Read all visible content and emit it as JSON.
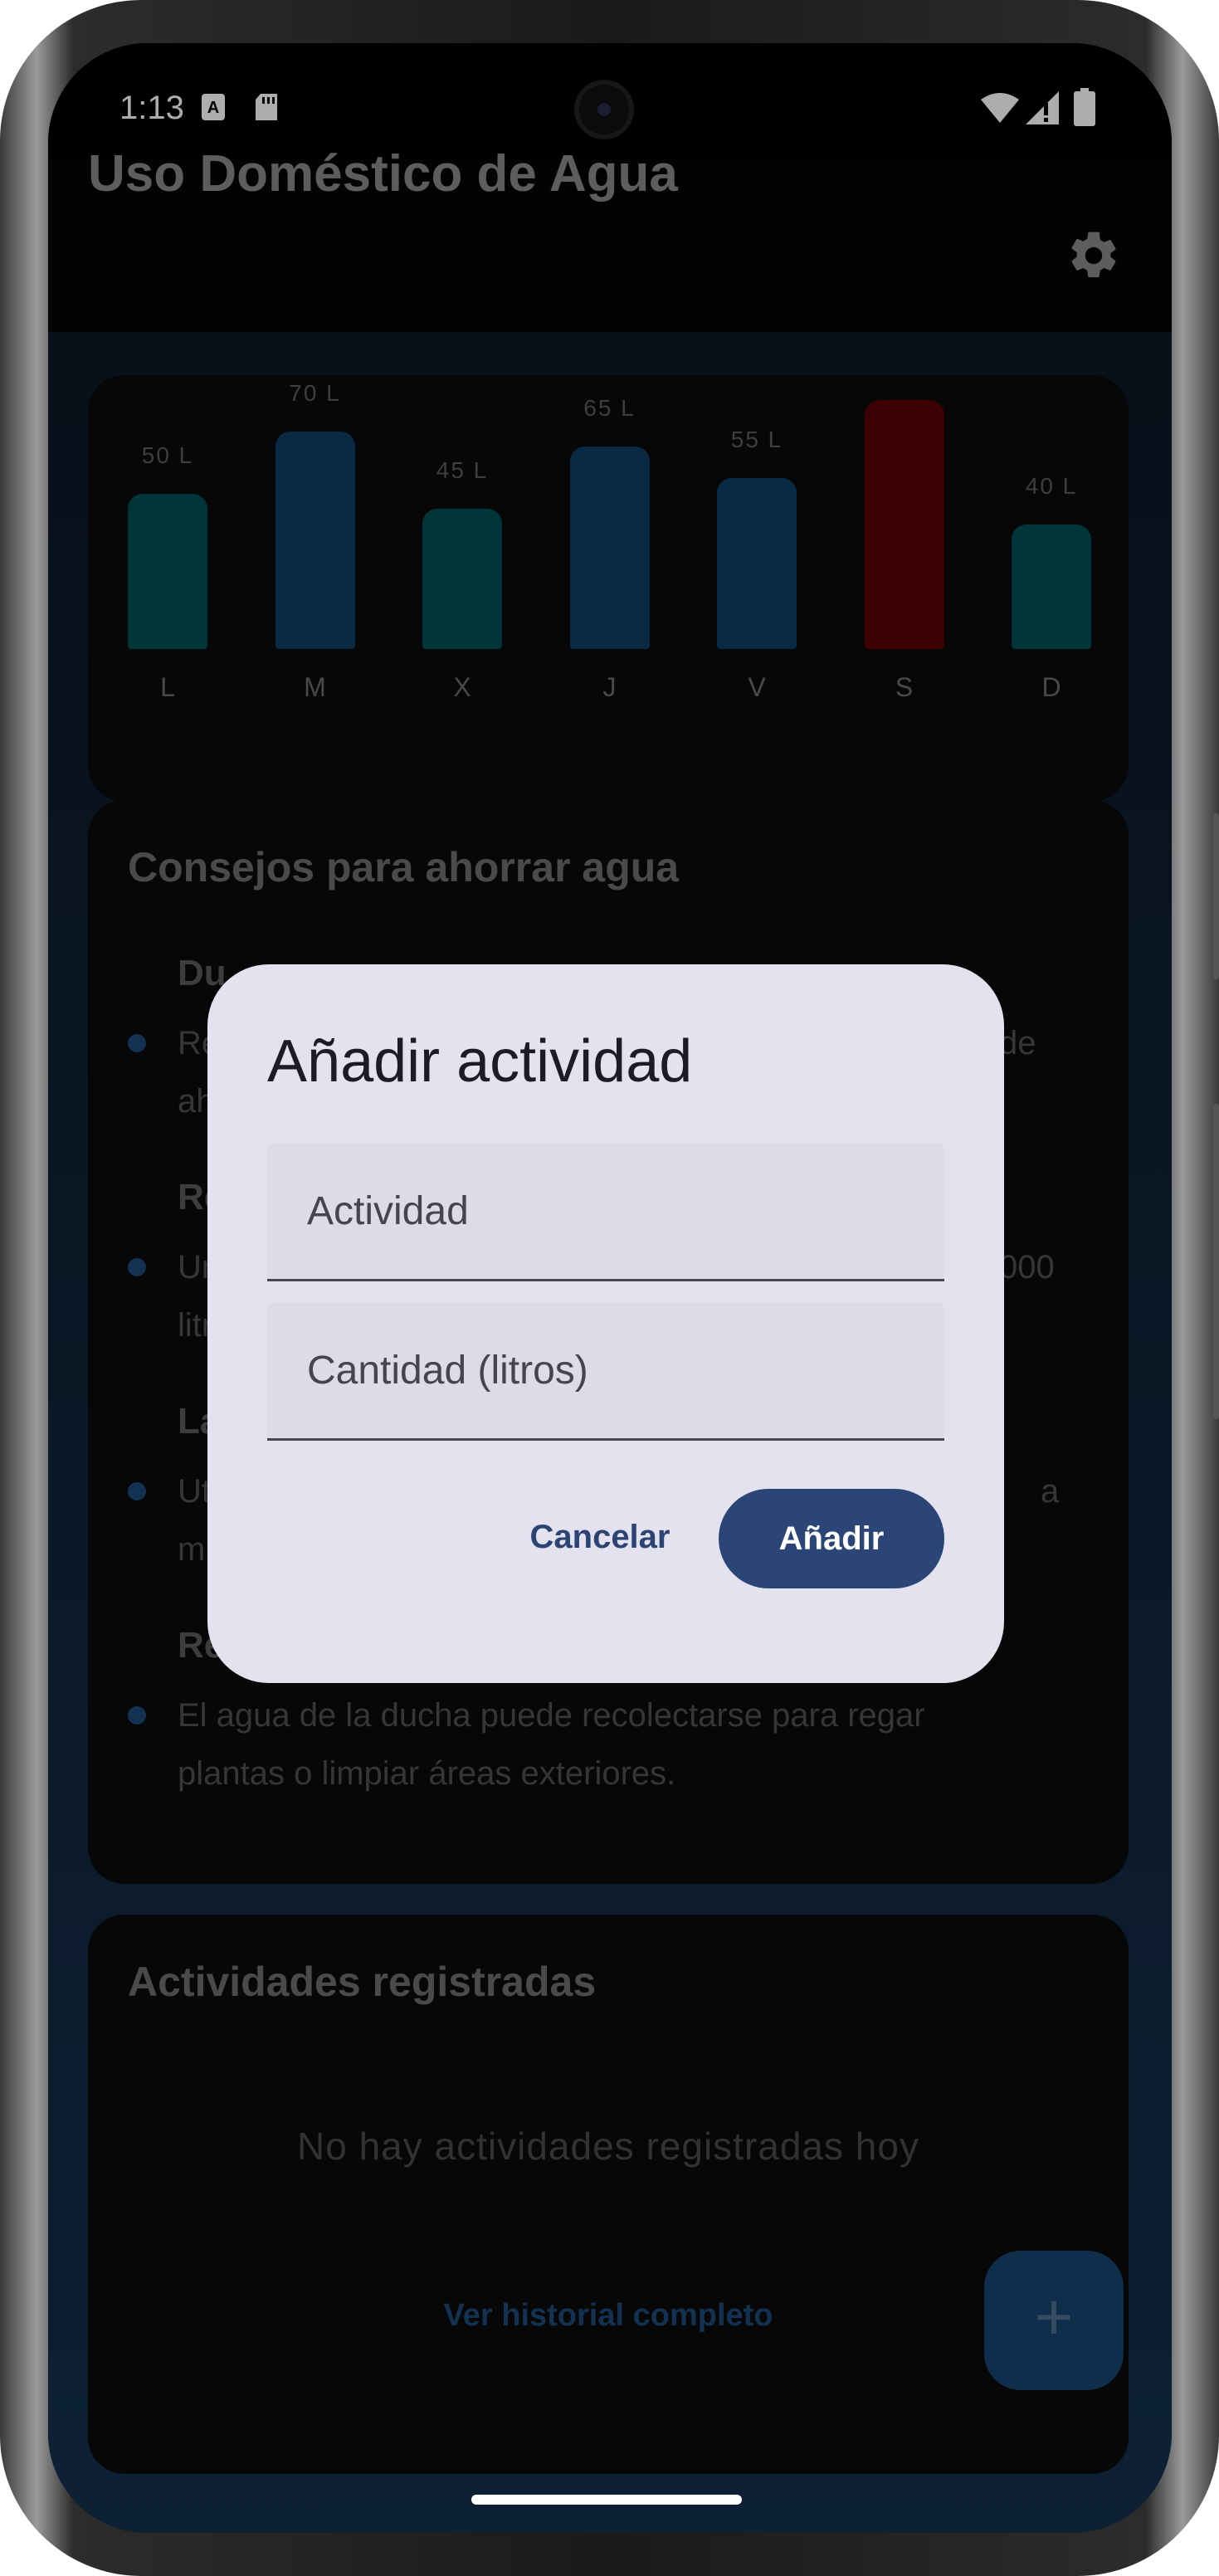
{
  "status_bar": {
    "time": "1:13",
    "left_icons": [
      "text-a-icon",
      "sd-card-icon"
    ],
    "right_icons": [
      "wifi-icon",
      "signal-icon",
      "battery-icon"
    ]
  },
  "app_bar": {
    "title": "Uso Doméstico de Agua",
    "settings_icon": "gear-icon"
  },
  "chart_data": {
    "type": "bar",
    "categories": [
      "L",
      "M",
      "X",
      "J",
      "V",
      "S",
      "D"
    ],
    "values": [
      50,
      70,
      45,
      65,
      55,
      80,
      40
    ],
    "value_labels": [
      "50 L",
      "70 L",
      "45 L",
      "65 L",
      "55 L",
      "",
      "40 L"
    ],
    "bar_colors": [
      "#004f55",
      "#0d3f66",
      "#004f55",
      "#0d3f66",
      "#0d3f66",
      "#5a0005",
      "#004f55"
    ],
    "ylim": [
      0,
      80
    ]
  },
  "tips": {
    "title": "Consejos para ahorrar agua",
    "items": [
      {
        "title": "Du",
        "text_lines": [
          "Re",
          "ah"
        ],
        "text_right": "de"
      },
      {
        "title": "Re",
        "text_lines": [
          "Ur",
          "litr"
        ],
        "text_right": "000"
      },
      {
        "title": "La",
        "text_lines": [
          "Ut",
          "m"
        ],
        "text_right": "a"
      },
      {
        "title": "Re",
        "text_lines": [
          "El agua de la ducha puede recolectarse para regar",
          "plantas o limpiar áreas exteriores."
        ],
        "text_right": ""
      }
    ]
  },
  "activities": {
    "title": "Actividades registradas",
    "empty_text": "No hay actividades registradas hoy",
    "history_link": "Ver historial completo"
  },
  "fab": {
    "label": "+",
    "icon": "plus-icon"
  },
  "dialog": {
    "title": "Añadir actividad",
    "activity_placeholder": "Actividad",
    "activity_value": "",
    "amount_placeholder": "Cantidad (litros)",
    "amount_value": "",
    "cancel_label": "Cancelar",
    "add_label": "Añadir"
  },
  "colors": {
    "dialog_bg": "#e3e2ee",
    "primary": "#2c4577",
    "scrim": "#000000"
  }
}
